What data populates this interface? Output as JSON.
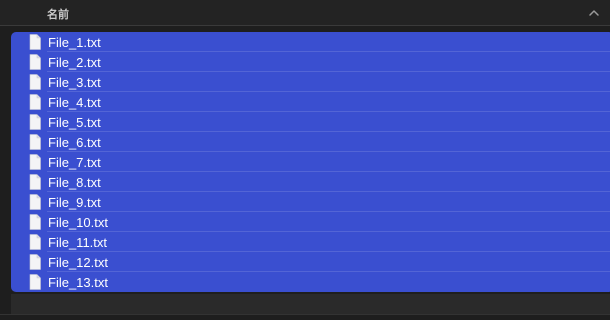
{
  "header": {
    "name_column": "名前"
  },
  "files": [
    "File_1.txt",
    "File_2.txt",
    "File_3.txt",
    "File_4.txt",
    "File_5.txt",
    "File_6.txt",
    "File_7.txt",
    "File_8.txt",
    "File_9.txt",
    "File_10.txt",
    "File_11.txt",
    "File_12.txt",
    "File_13.txt"
  ],
  "colors": {
    "selection": "#3a4fd0",
    "background": "#1e1e1e"
  },
  "icons": {
    "file": "text-file-icon",
    "sort": "chevron-up-icon"
  }
}
